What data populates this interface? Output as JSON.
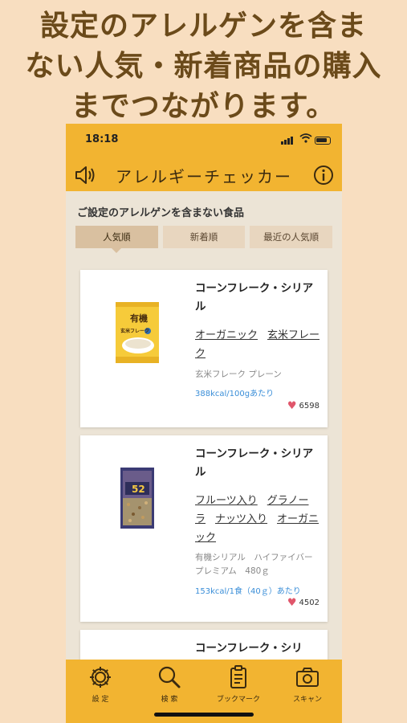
{
  "headline": {
    "line1": "設定のアレルゲンを含ま",
    "line2": "ない人気・新着商品の購入",
    "line3": "までつながります。"
  },
  "status": {
    "time": "18:18"
  },
  "nav": {
    "title": "アレルギーチェッカー"
  },
  "section_title": "ご設定のアレルゲンを含まない食品",
  "tabs": [
    {
      "label": "人気順"
    },
    {
      "label": "新着順"
    },
    {
      "label": "最近の人気順"
    }
  ],
  "products": [
    {
      "name": "コーンフレーク・シリアル",
      "tags": [
        "オーガニック",
        "玄米フレーク"
      ],
      "desc": "玄米フレーク プレーン",
      "kcal": "388kcal/100gあたり",
      "likes": "6598",
      "package": {
        "text1": "有機",
        "text2": "玄米フレーク"
      }
    },
    {
      "name": "コーンフレーク・シリアル",
      "tags": [
        "フルーツ入り",
        "グラノーラ",
        "ナッツ入り",
        "オーガニック"
      ],
      "desc": "有機シリアル　ハイファイバー　プレミアム　480ｇ",
      "kcal": "153kcal/1食（40ｇ）あたり",
      "likes": "4502",
      "package": {
        "text1": "52"
      }
    },
    {
      "name": "コーンフレーク・シリ"
    }
  ],
  "tabbar": [
    {
      "label": "設 定",
      "icon": "gear-icon"
    },
    {
      "label": "検 索",
      "icon": "search-icon"
    },
    {
      "label": "ブックマーク",
      "icon": "bookmark-list-icon"
    },
    {
      "label": "スキャン",
      "icon": "camera-icon"
    }
  ],
  "colors": {
    "accent": "#f2b431",
    "background": "#f8dec0",
    "headline": "#6b4a1a",
    "kcal": "#3a8ed8",
    "heart": "#e0566b"
  }
}
